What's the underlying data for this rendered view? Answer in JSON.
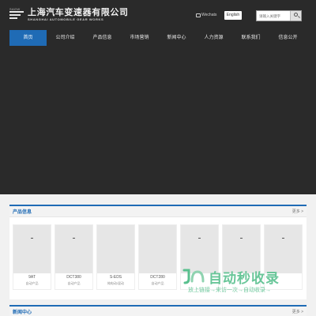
{
  "header": {
    "logo_badge": "SAGW",
    "logo_cn": "上海汽车变速器有限公司",
    "logo_en": "SHANGHAI AUTOMOBILE GEAR WORKS",
    "wechat_label": "Wechats",
    "lang_button": "English",
    "search_placeholder": "请输入关键字"
  },
  "nav": {
    "items": [
      {
        "label": "首页"
      },
      {
        "label": "公司介绍"
      },
      {
        "label": "产品信息"
      },
      {
        "label": "市场营销"
      },
      {
        "label": "新闻中心"
      },
      {
        "label": "人力资源"
      },
      {
        "label": "联系我们"
      },
      {
        "label": "信息公开"
      }
    ],
    "active_index": 0
  },
  "products": {
    "title": "产品信息",
    "more": "更多 >",
    "items": [
      {
        "name": "9AT",
        "sub": "自动产品"
      },
      {
        "name": "DCT380",
        "sub": "自动产品"
      },
      {
        "name": "S-EDS",
        "sub": "纯电动/混动"
      },
      {
        "name": "DCT280",
        "sub": "自动产品"
      },
      {
        "name": "",
        "sub": ""
      },
      {
        "name": "",
        "sub": ""
      },
      {
        "name": "",
        "sub": ""
      }
    ]
  },
  "watermark": {
    "title": "自动秒收录",
    "subtitle": "放上链接→来访一次→自动收录→"
  },
  "news": {
    "title": "新闻中心",
    "more": "更多 >"
  },
  "colors": {
    "header_bg": "#2a2a2a",
    "accent": "#1f6bb5",
    "page_bg": "#f1f1f1",
    "watermark": "#59c08e"
  }
}
